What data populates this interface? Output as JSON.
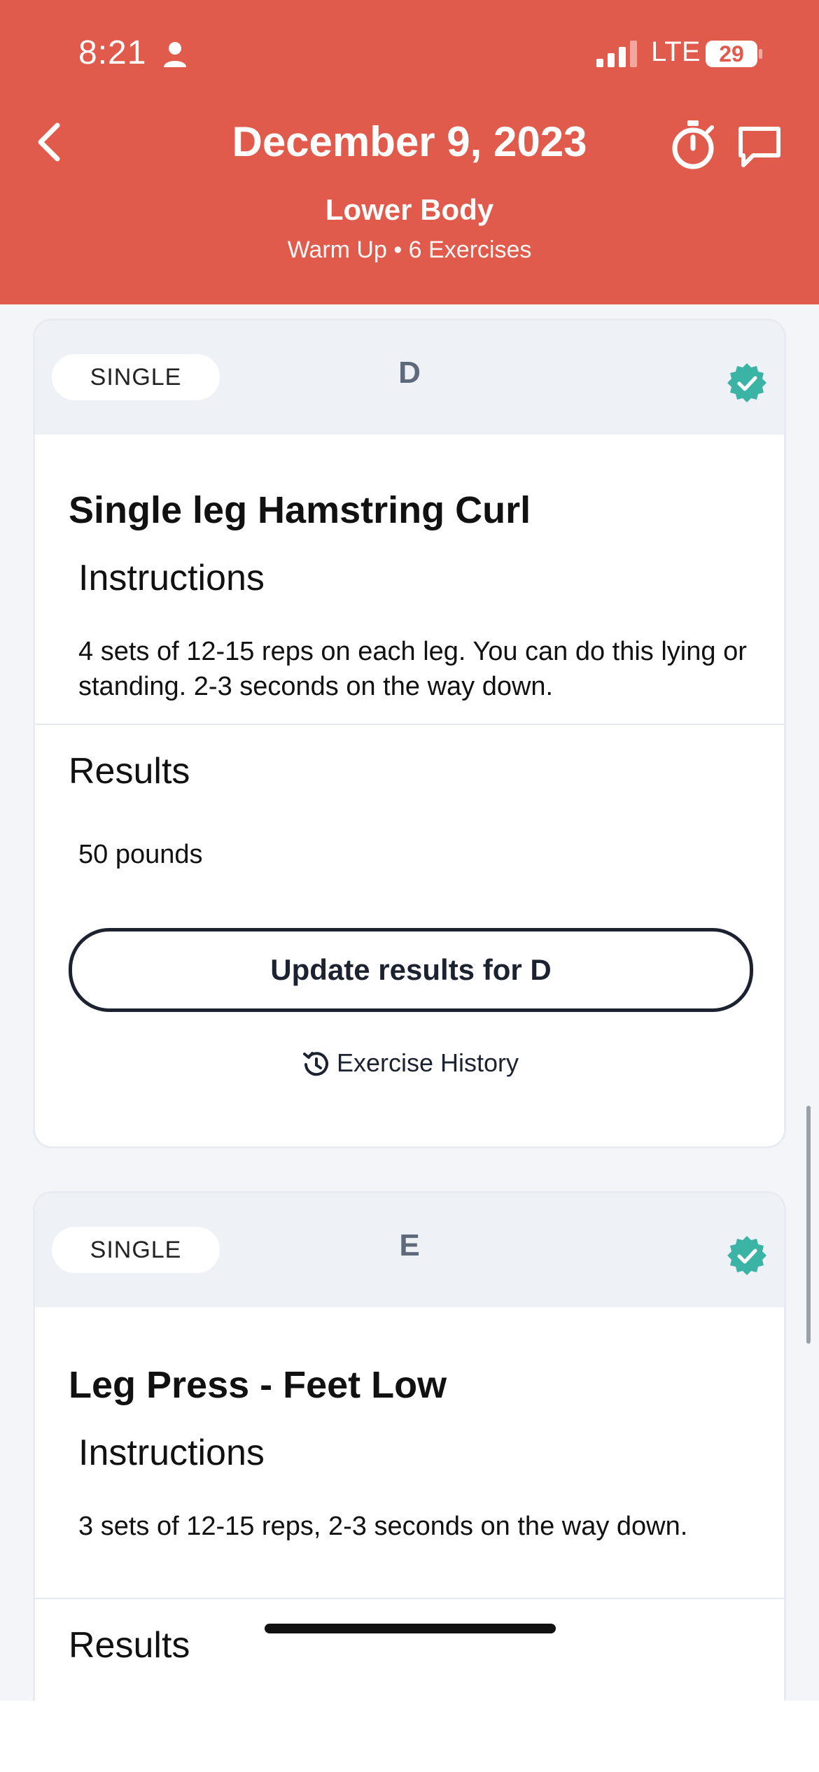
{
  "status_bar": {
    "time": "8:21",
    "network": "LTE",
    "battery": "29"
  },
  "header": {
    "title": "December 9, 2023",
    "subtitle": "Lower Body",
    "meta": "Warm Up • 6 Exercises"
  },
  "cards": [
    {
      "type_label": "SINGLE",
      "letter": "D",
      "exercise_title": "Single leg Hamstring Curl",
      "instructions_heading": "Instructions",
      "instructions_text": "4 sets of 12-15 reps on each leg. You can do this lying or standing. 2-3 seconds on the way down.",
      "results_heading": "Results",
      "results_text": "50 pounds",
      "update_button": "Update results for D",
      "history_link": "Exercise History"
    },
    {
      "type_label": "SINGLE",
      "letter": "E",
      "exercise_title": "Leg Press - Feet Low",
      "instructions_heading": "Instructions",
      "instructions_text": "3 sets of 12-15 reps, 2-3 seconds on the way down.",
      "results_heading": "Results"
    }
  ],
  "colors": {
    "header": "#e05b4b",
    "check_badge": "#3bb3a5",
    "letter": "#5e6a7a"
  },
  "icons": [
    "person-icon",
    "signal-icon",
    "battery-icon",
    "back-chevron-icon",
    "timer-icon",
    "chat-icon",
    "check-badge-icon",
    "history-icon"
  ]
}
